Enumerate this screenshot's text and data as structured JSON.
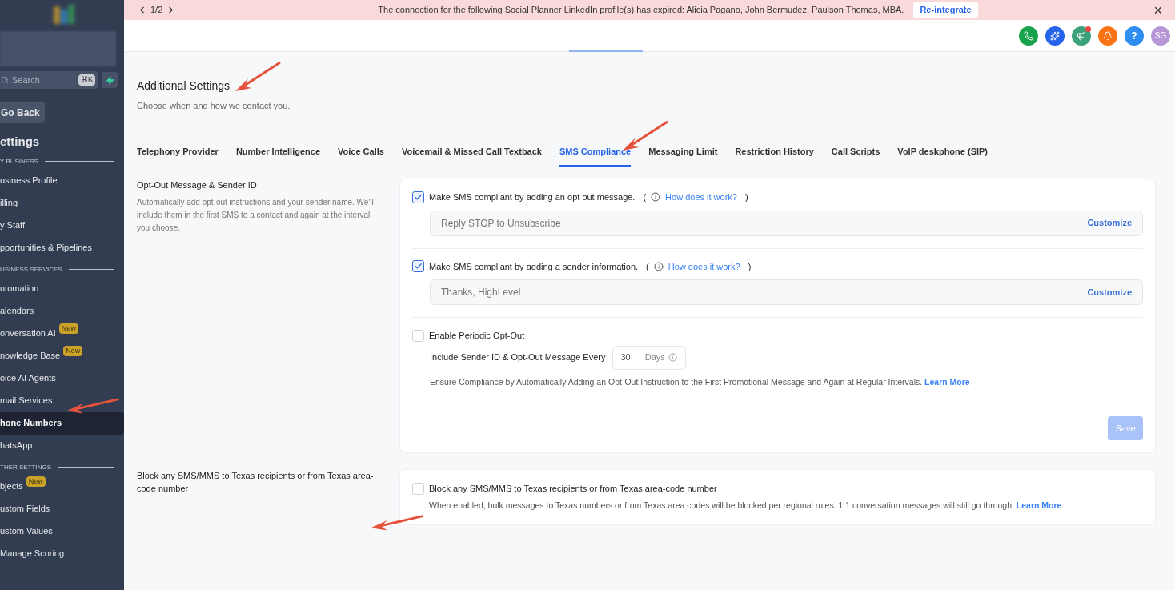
{
  "banner": {
    "pager": "1/2",
    "message": "The connection for the following Social Planner LinkedIn profile(s) has expired: Alicia Pagano, John Bermudez, Paulson Thomas, MBA.",
    "action": "Re-integrate",
    "close": "×"
  },
  "header": {
    "avatar": "SG",
    "help": "?"
  },
  "sidebar": {
    "search": {
      "placeholder": "Search",
      "shortcut": "⌘K"
    },
    "back": "Go Back",
    "title": "ettings",
    "sections": [
      {
        "heading": "Y BUSINESS",
        "items": [
          {
            "label": "usiness Profile",
            "selected": false
          },
          {
            "label": "illing",
            "selected": false
          },
          {
            "label": "y Staff",
            "selected": false
          },
          {
            "label": "pportunities & Pipelines",
            "selected": false
          }
        ]
      },
      {
        "heading": "USINESS SERVICES",
        "items": [
          {
            "label": "utomation",
            "selected": false
          },
          {
            "label": "alendars",
            "selected": false
          },
          {
            "label": "onversation AI",
            "selected": false,
            "badge": "New"
          },
          {
            "label": "nowledge Base",
            "selected": false,
            "badge": "New"
          },
          {
            "label": "oice AI Agents",
            "selected": false
          },
          {
            "label": "mail Services",
            "selected": false
          },
          {
            "label": "hone Numbers",
            "selected": true
          },
          {
            "label": "hatsApp",
            "selected": false
          }
        ]
      },
      {
        "heading": "THER SETTINGS",
        "items": [
          {
            "label": "bjects",
            "selected": false,
            "badge": "New"
          },
          {
            "label": "ustom Fields",
            "selected": false
          },
          {
            "label": "ustom Values",
            "selected": false
          },
          {
            "label": "Manage Scoring",
            "selected": false
          }
        ]
      }
    ]
  },
  "page": {
    "title": "Additional Settings",
    "subtitle": "Choose when and how we contact you.",
    "tabs": [
      {
        "label": "Telephony Provider",
        "selected": false
      },
      {
        "label": "Number Intelligence",
        "selected": false
      },
      {
        "label": "Voice Calls",
        "selected": false
      },
      {
        "label": "Voicemail & Missed Call Textback",
        "selected": false
      },
      {
        "label": "SMS Compliance",
        "selected": true
      },
      {
        "label": "Messaging Limit",
        "selected": false
      },
      {
        "label": "Restriction History",
        "selected": false
      },
      {
        "label": "Call Scripts",
        "selected": false
      },
      {
        "label": "VoIP deskphone (SIP)",
        "selected": false
      }
    ],
    "opt_out": {
      "title": "Opt-Out Message & Sender ID",
      "description": "Automatically add opt-out instructions and your sender name. We'll include them in the first SMS to a contact and again at the interval you choose.",
      "options": [
        {
          "label": "Make SMS compliant by adding an opt out message.",
          "checked": true,
          "paren_open": "(",
          "help_link": "How does it work?",
          "paren_close": ")",
          "value": "Reply STOP to Unsubscribe",
          "action": "Customize"
        },
        {
          "label": "Make SMS compliant by adding a sender information.",
          "checked": true,
          "paren_open": "(",
          "help_link": "How does it work?",
          "paren_close": ")",
          "value": "Thanks, HighLevel",
          "action": "Customize"
        }
      ],
      "periodic": {
        "label": "Enable Periodic Opt-Out",
        "checked": false,
        "interval_label": "Include Sender ID & Opt-Out Message Every",
        "interval": "30",
        "unit": "Days",
        "note": "Ensure Compliance by Automatically Adding an Opt-Out Instruction to the First Promotional Message and Again at Regular Intervals.",
        "link": "Learn More"
      },
      "save": {
        "label": "Save",
        "disabled": true
      }
    },
    "texas": {
      "title": "Block any SMS/MMS to Texas recipients or from Texas area-code number",
      "label": "Block any SMS/MMS to Texas recipients or from Texas area-code number",
      "checked": false,
      "note": "When enabled, bulk messages to Texas numbers or from Texas area codes will be blocked per regional rules. 1:1 conversation messages will still go through.",
      "link": "Learn More"
    }
  }
}
